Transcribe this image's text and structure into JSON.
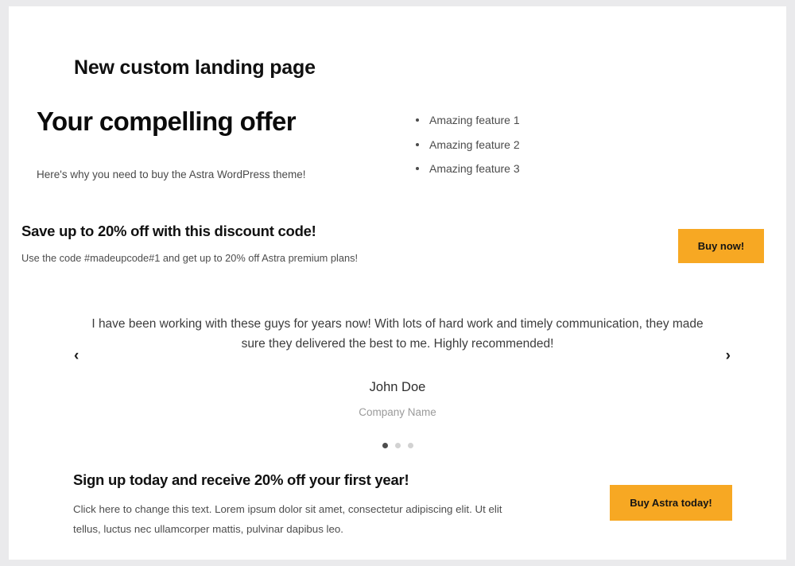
{
  "page": {
    "title": "New custom landing page"
  },
  "hero": {
    "heading": "Your compelling offer",
    "subheading": "Here's why you need to buy the Astra WordPress theme!",
    "features": [
      {
        "label": "Amazing feature 1"
      },
      {
        "label": "Amazing feature 2"
      },
      {
        "label": "Amazing feature 3"
      }
    ]
  },
  "discount": {
    "heading": "Save up to 20% off with this discount code!",
    "subheading": "Use the code #madeupcode#1 and get up to 20% off Astra premium plans!",
    "button_label": "Buy now!"
  },
  "testimonial": {
    "quote": "I have been working with these guys for years now! With lots of hard work and timely communication, they made sure they delivered the best to me. Highly recommended!",
    "author": "John Doe",
    "company": "Company Name",
    "prev_icon": "chevron-left-icon",
    "prev_glyph": "‹",
    "next_icon": "chevron-right-icon",
    "next_glyph": "›",
    "dots": [
      {
        "active": true
      },
      {
        "active": false
      },
      {
        "active": false
      }
    ]
  },
  "signup": {
    "heading": "Sign up today and receive 20% off your first year!",
    "body": "Click here to change this text. Lorem ipsum dolor sit amet, consectetur adipiscing elit. Ut elit tellus, luctus nec ullamcorper mattis, pulvinar dapibus leo.",
    "button_label": "Buy Astra today!"
  },
  "colors": {
    "accent_orange": "#f7a823",
    "page_background": "#eaeaec",
    "canvas": "#ffffff",
    "heading_text": "#101010",
    "body_text": "#4d4d4d",
    "muted_text": "#9a9a9a",
    "dot_active": "#4d4d4d",
    "dot_inactive": "#d2d2d2"
  }
}
